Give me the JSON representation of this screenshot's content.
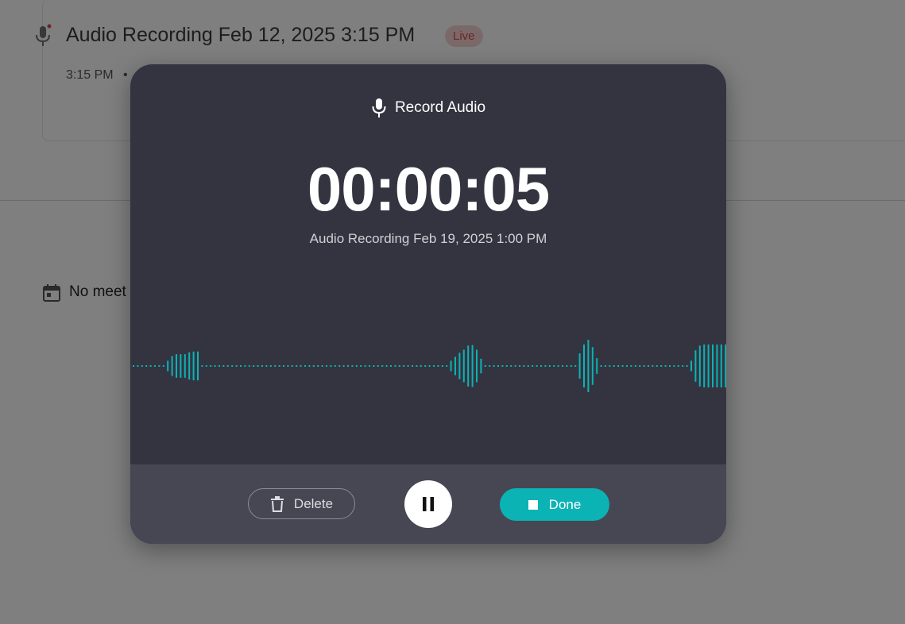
{
  "background": {
    "recording_title": "Audio Recording Feb 12, 2025 3:15 PM",
    "live_badge": "Live",
    "meta_time": "3:15 PM",
    "meta_separator": "•",
    "no_meetings_text": "No meet",
    "badge_color": "#d84c4c"
  },
  "modal": {
    "title": "Record Audio",
    "timer": "00:00:05",
    "recording_name": "Audio Recording Feb 19, 2025 1:00 PM",
    "accent_color": "#0bb3b5",
    "waveform_levels": [
      0.02,
      0.02,
      0.02,
      0.02,
      0.02,
      0.02,
      0.02,
      0.02,
      0.2,
      0.38,
      0.45,
      0.45,
      0.45,
      0.52,
      0.55,
      0.55,
      0.02,
      0.02,
      0.02,
      0.02,
      0.02,
      0.02,
      0.02,
      0.02,
      0.02,
      0.02,
      0.02,
      0.02,
      0.02,
      0.02,
      0.02,
      0.02,
      0.02,
      0.02,
      0.02,
      0.02,
      0.02,
      0.02,
      0.02,
      0.02,
      0.02,
      0.02,
      0.02,
      0.02,
      0.02,
      0.02,
      0.02,
      0.02,
      0.02,
      0.02,
      0.02,
      0.02,
      0.02,
      0.02,
      0.02,
      0.02,
      0.02,
      0.02,
      0.02,
      0.02,
      0.02,
      0.02,
      0.02,
      0.02,
      0.02,
      0.02,
      0.02,
      0.02,
      0.02,
      0.02,
      0.02,
      0.02,
      0.02,
      0.02,
      0.2,
      0.35,
      0.5,
      0.62,
      0.78,
      0.8,
      0.62,
      0.28,
      0.02,
      0.02,
      0.02,
      0.02,
      0.02,
      0.02,
      0.02,
      0.02,
      0.02,
      0.02,
      0.02,
      0.02,
      0.02,
      0.02,
      0.02,
      0.02,
      0.02,
      0.02,
      0.02,
      0.02,
      0.02,
      0.02,
      0.48,
      0.82,
      1.0,
      0.72,
      0.3,
      0.02,
      0.02,
      0.02,
      0.02,
      0.02,
      0.02,
      0.02,
      0.02,
      0.02,
      0.02,
      0.02,
      0.02,
      0.02,
      0.02,
      0.02,
      0.02,
      0.02,
      0.02,
      0.02,
      0.02,
      0.02,
      0.2,
      0.6,
      0.78,
      0.82,
      0.82,
      0.82,
      0.82,
      0.82,
      0.82
    ]
  },
  "footer": {
    "delete_label": "Delete",
    "pause_label": "Pause",
    "done_label": "Done"
  },
  "icons": {
    "background_mic": "microphone-icon",
    "calendar": "calendar-icon",
    "modal_mic": "microphone-icon",
    "delete": "trash-icon",
    "pause": "pause-icon",
    "done": "stop-icon"
  }
}
